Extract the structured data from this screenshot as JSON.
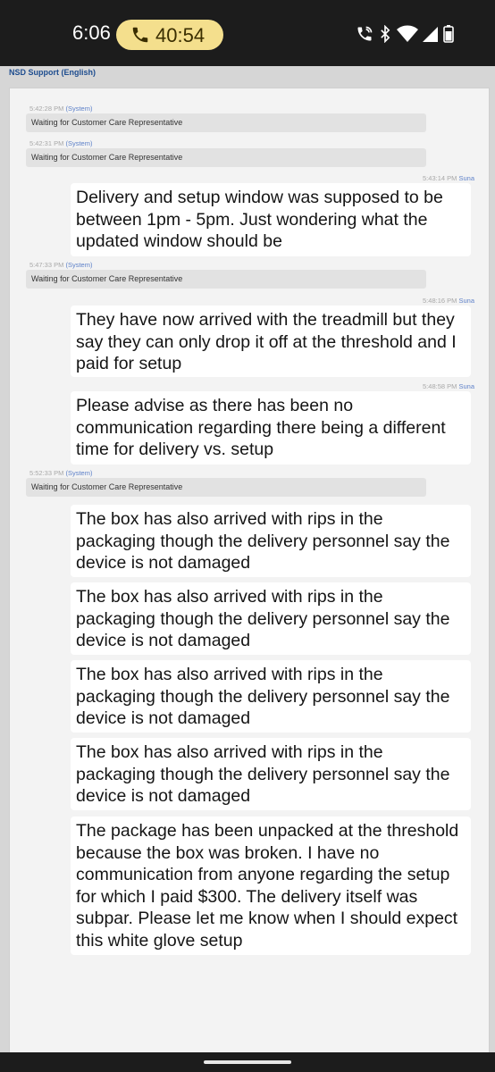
{
  "status_bar": {
    "time": "6:06",
    "call_timer": "40:54",
    "icons": [
      "phone-call-icon",
      "bluetooth-icon",
      "wifi-icon",
      "cell-signal-icon",
      "battery-icon"
    ]
  },
  "app": {
    "title": "NSD Support (English)"
  },
  "messages": [
    {
      "type": "system",
      "time": "5:42:28 PM",
      "sender": "(System)",
      "text": "Waiting for Customer Care Representative"
    },
    {
      "type": "system",
      "time": "5:42:31 PM",
      "sender": "(System)",
      "text": "Waiting for Customer Care Representative"
    },
    {
      "type": "customer",
      "time": "5:43:14 PM",
      "sender": "Suna",
      "text": "Delivery and setup window was supposed to be between 1pm - 5pm. Just wondering what the updated window should be"
    },
    {
      "type": "system",
      "time": "5:47:33 PM",
      "sender": "(System)",
      "text": "Waiting for Customer Care Representative"
    },
    {
      "type": "customer",
      "time": "5:48:16 PM",
      "sender": "Suna",
      "text": "They have now arrived with the treadmill but they say they can only drop it off at the threshold and I paid for setup"
    },
    {
      "type": "customer",
      "time": "5:48:58 PM",
      "sender": "Suna",
      "text": "Please advise as there has been no communication regarding there being a different time for delivery vs. setup"
    },
    {
      "type": "system",
      "time": "5:52:33 PM",
      "sender": "(System)",
      "text": "Waiting for Customer Care Representative"
    },
    {
      "type": "customer",
      "time": "",
      "sender": "",
      "text": "The box has also arrived with rips in the packaging though the delivery personnel say the device is not damaged"
    },
    {
      "type": "customer",
      "time": "",
      "sender": "",
      "text": "The box has also arrived with rips in the packaging though the delivery personnel say the device is not damaged"
    },
    {
      "type": "customer",
      "time": "",
      "sender": "",
      "text": "The box has also arrived with rips in the packaging though the delivery personnel say the device is not damaged"
    },
    {
      "type": "customer",
      "time": "",
      "sender": "",
      "text": "The box has also arrived with rips in the packaging though the delivery personnel say the device is not damaged"
    },
    {
      "type": "customer",
      "time": "",
      "sender": "",
      "text": "The package has been unpacked at the threshold because the box was broken. I have no communication from anyone regarding the setup for which I paid $300. The delivery itself was subpar. Please let me know when I should expect this white glove setup"
    }
  ]
}
